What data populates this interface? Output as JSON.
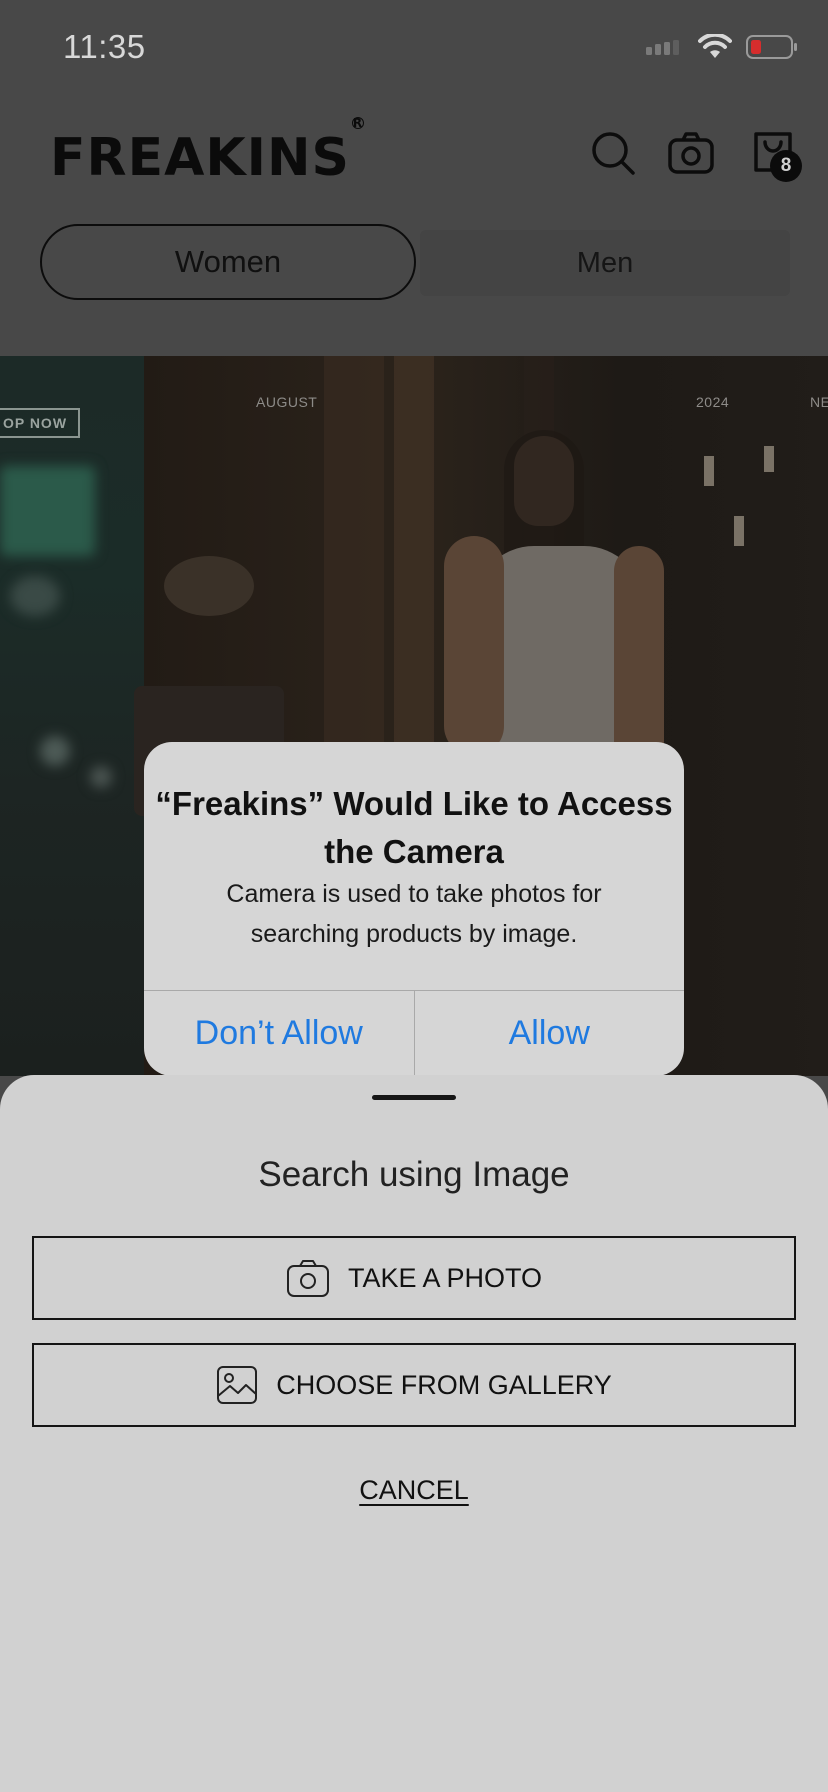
{
  "status_bar": {
    "time": "11:35"
  },
  "header": {
    "logo": "FREAKINS",
    "logo_mark": "R",
    "cart_count": "8",
    "tabs": [
      {
        "label": "Women"
      },
      {
        "label": "Men"
      }
    ]
  },
  "hero": {
    "cta": "OP NOW",
    "labels": [
      "AUGUST",
      "2024",
      "NE"
    ]
  },
  "permission_dialog": {
    "title": "“Freakins” Would Like to Access the Camera",
    "message": "Camera is used to take photos for searching products by image.",
    "deny_label": "Don’t Allow",
    "allow_label": "Allow"
  },
  "image_search_sheet": {
    "title": "Search using Image",
    "take_photo_label": "TAKE A PHOTO",
    "gallery_label": "CHOOSE FROM GALLERY",
    "cancel_label": "CANCEL"
  },
  "colors": {
    "accent": "#1f7ae0",
    "overlay": "#484848",
    "sheet": "#d1d1d1"
  }
}
